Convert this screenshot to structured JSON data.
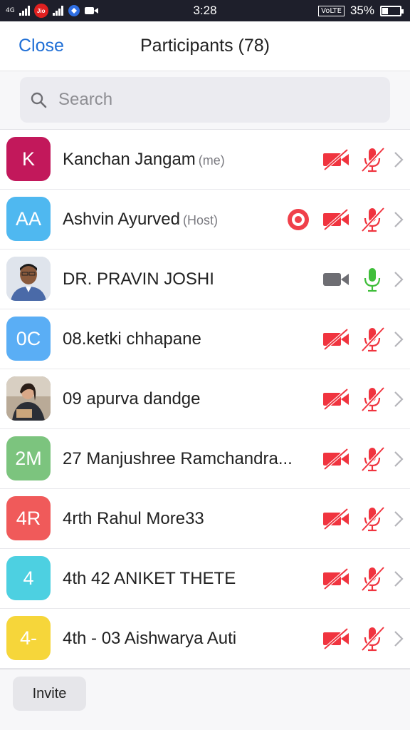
{
  "status_bar": {
    "network": "4G",
    "carrier_badge": "Jio",
    "time": "3:28",
    "volte": "VoLTE",
    "battery_percent": "35%",
    "battery_level": 0.35
  },
  "header": {
    "close_label": "Close",
    "title": "Participants (78)"
  },
  "search": {
    "placeholder": "Search"
  },
  "colors": {
    "accent": "#1f6fd6",
    "muted_red": "#f0343f",
    "unmuted_green": "#3fbe3a",
    "video_on_gray": "#6e6e73"
  },
  "participants": [
    {
      "name": "Kanchan Jangam",
      "tag": "(me)",
      "initials": "K",
      "avatar_color": "#c2185b",
      "avatar_type": "initials",
      "recording": false,
      "video": "off",
      "audio": "muted"
    },
    {
      "name": "Ashvin Ayurved",
      "tag": "(Host)",
      "initials": "AA",
      "avatar_color": "#4fb8f0",
      "avatar_type": "initials",
      "recording": true,
      "video": "off",
      "audio": "muted"
    },
    {
      "name": "DR. PRAVIN JOSHI",
      "tag": "",
      "initials": "",
      "avatar_color": "#d7dde6",
      "avatar_type": "photo-man",
      "recording": false,
      "video": "on",
      "audio": "unmuted"
    },
    {
      "name": "08.ketki chhapane",
      "tag": "",
      "initials": "0C",
      "avatar_color": "#5aaef5",
      "avatar_type": "initials",
      "recording": false,
      "video": "off",
      "audio": "muted"
    },
    {
      "name": "09 apurva dandge",
      "tag": "",
      "initials": "",
      "avatar_color": "#8a7a6a",
      "avatar_type": "photo-woman",
      "recording": false,
      "video": "off",
      "audio": "muted"
    },
    {
      "name": "27 Manjushree Ramchandra...",
      "tag": "",
      "initials": "2M",
      "avatar_color": "#7cc47e",
      "avatar_type": "initials",
      "recording": false,
      "video": "off",
      "audio": "muted"
    },
    {
      "name": "4rth Rahul More33",
      "tag": "",
      "initials": "4R",
      "avatar_color": "#f05a5a",
      "avatar_type": "initials",
      "recording": false,
      "video": "off",
      "audio": "muted"
    },
    {
      "name": "4th  42 ANIKET THETE",
      "tag": "",
      "initials": "4",
      "avatar_color": "#4dd0e1",
      "avatar_type": "initials",
      "recording": false,
      "video": "off",
      "audio": "muted"
    },
    {
      "name": "4th - 03 Aishwarya Auti",
      "tag": "",
      "initials": "4-",
      "avatar_color": "#f6d63a",
      "avatar_type": "initials",
      "recording": false,
      "video": "off",
      "audio": "muted"
    }
  ],
  "footer": {
    "invite_label": "Invite"
  }
}
